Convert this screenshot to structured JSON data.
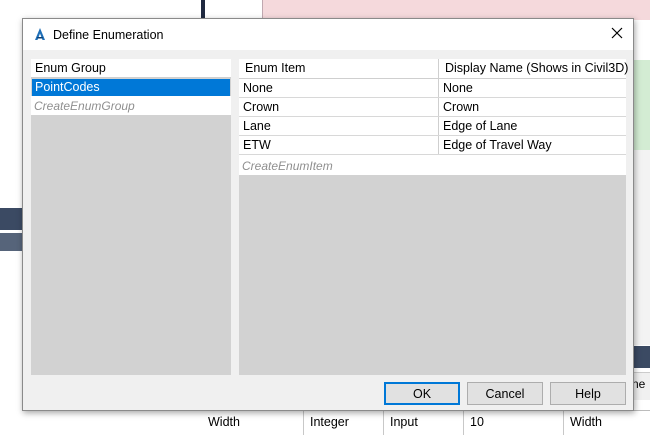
{
  "background": {
    "table_cells": [
      "Width",
      "Integer",
      "Input",
      "10",
      "Width"
    ],
    "right_header_fragment": "ne"
  },
  "dialog": {
    "title": "Define Enumeration",
    "icon": "autodesk-a-icon",
    "enum_group_header": "Enum Group",
    "groups": [
      {
        "label": "PointCodes",
        "selected": true
      }
    ],
    "create_group_label": "CreateEnumGroup",
    "item_columns": [
      "Enum Item",
      "Display Name (Shows in Civil3D)"
    ],
    "items": [
      {
        "item": "None",
        "display": "None"
      },
      {
        "item": "Crown",
        "display": "Crown"
      },
      {
        "item": "Lane",
        "display": "Edge of Lane"
      },
      {
        "item": "ETW",
        "display": "Edge of Travel Way"
      }
    ],
    "create_item_label": "CreateEnumItem",
    "buttons": {
      "ok": "OK",
      "cancel": "Cancel",
      "help": "Help"
    }
  },
  "colors": {
    "selection": "#0078d7",
    "panel_gray": "#d2d2d2",
    "dialog_bg": "#f0f0f0"
  }
}
